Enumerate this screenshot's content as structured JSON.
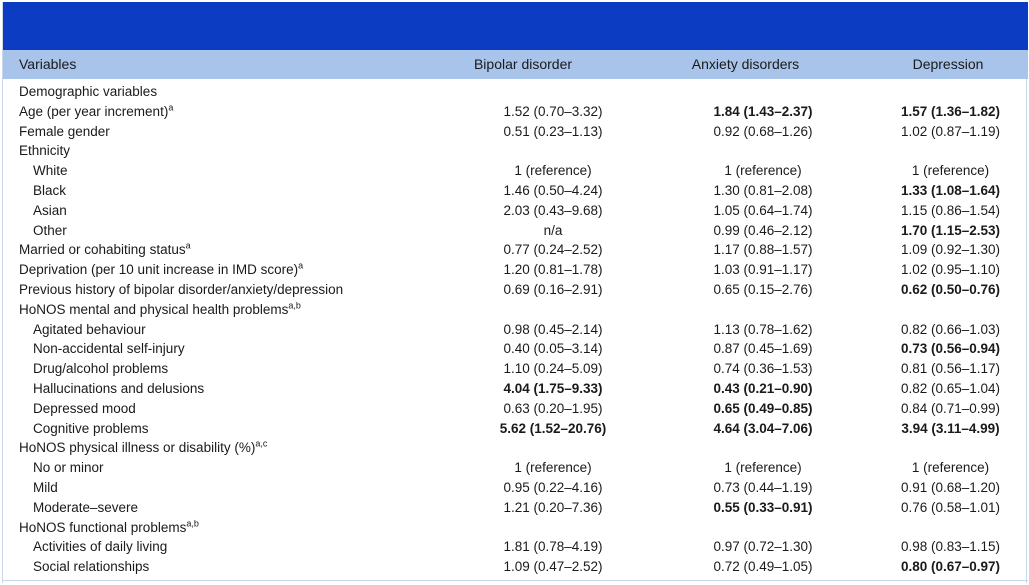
{
  "header": {
    "variables": "Variables",
    "bipolar": "Bipolar disorder",
    "anxiety": "Anxiety disorders",
    "depression": "Depression"
  },
  "rows": [
    {
      "label": "Demographic variables",
      "sup": "",
      "indent": false,
      "v": [
        "",
        "",
        ""
      ],
      "b": [
        false,
        false,
        false
      ]
    },
    {
      "label": "Age (per year increment)",
      "sup": "a",
      "indent": false,
      "v": [
        "1.52 (0.70–3.32)",
        "1.84 (1.43–2.37)",
        "1.57 (1.36–1.82)"
      ],
      "b": [
        false,
        true,
        true
      ]
    },
    {
      "label": "Female gender",
      "sup": "",
      "indent": false,
      "v": [
        "0.51 (0.23–1.13)",
        "0.92 (0.68–1.26)",
        "1.02 (0.87–1.19)"
      ],
      "b": [
        false,
        false,
        false
      ]
    },
    {
      "label": "Ethnicity",
      "sup": "",
      "indent": false,
      "v": [
        "",
        "",
        ""
      ],
      "b": [
        false,
        false,
        false
      ]
    },
    {
      "label": "White",
      "sup": "",
      "indent": true,
      "v": [
        "1 (reference)",
        "1 (reference)",
        "1 (reference)"
      ],
      "b": [
        false,
        false,
        false
      ]
    },
    {
      "label": "Black",
      "sup": "",
      "indent": true,
      "v": [
        "1.46 (0.50–4.24)",
        "1.30 (0.81–2.08)",
        "1.33 (1.08–1.64)"
      ],
      "b": [
        false,
        false,
        true
      ]
    },
    {
      "label": "Asian",
      "sup": "",
      "indent": true,
      "v": [
        "2.03 (0.43–9.68)",
        "1.05 (0.64–1.74)",
        "1.15 (0.86–1.54)"
      ],
      "b": [
        false,
        false,
        false
      ]
    },
    {
      "label": "Other",
      "sup": "",
      "indent": true,
      "v": [
        "n/a",
        "0.99 (0.46–2.12)",
        "1.70 (1.15–2.53)"
      ],
      "b": [
        false,
        false,
        true
      ]
    },
    {
      "label": "Married or cohabiting status",
      "sup": "a",
      "indent": false,
      "v": [
        "0.77 (0.24–2.52)",
        "1.17 (0.88–1.57)",
        "1.09 (0.92–1.30)"
      ],
      "b": [
        false,
        false,
        false
      ]
    },
    {
      "label": "Deprivation (per 10 unit increase in IMD score)",
      "sup": "a",
      "indent": false,
      "v": [
        "1.20 (0.81–1.78)",
        "1.03 (0.91–1.17)",
        "1.02 (0.95–1.10)"
      ],
      "b": [
        false,
        false,
        false
      ]
    },
    {
      "label": "Previous history of bipolar disorder/anxiety/depression",
      "sup": "",
      "indent": false,
      "v": [
        "0.69 (0.16–2.91)",
        "0.65 (0.15–2.76)",
        "0.62 (0.50–0.76)"
      ],
      "b": [
        false,
        false,
        true
      ]
    },
    {
      "label": "HoNOS mental and physical health problems",
      "sup": "a,b",
      "indent": false,
      "v": [
        "",
        "",
        ""
      ],
      "b": [
        false,
        false,
        false
      ]
    },
    {
      "label": "Agitated behaviour",
      "sup": "",
      "indent": true,
      "v": [
        "0.98 (0.45–2.14)",
        "1.13 (0.78–1.62)",
        "0.82 (0.66–1.03)"
      ],
      "b": [
        false,
        false,
        false
      ]
    },
    {
      "label": "Non-accidental self-injury",
      "sup": "",
      "indent": true,
      "v": [
        "0.40 (0.05–3.14)",
        "0.87 (0.45–1.69)",
        "0.73 (0.56–0.94)"
      ],
      "b": [
        false,
        false,
        true
      ]
    },
    {
      "label": "Drug/alcohol problems",
      "sup": "",
      "indent": true,
      "v": [
        "1.10 (0.24–5.09)",
        "0.74 (0.36–1.53)",
        "0.81 (0.56–1.17)"
      ],
      "b": [
        false,
        false,
        false
      ]
    },
    {
      "label": "Hallucinations and delusions",
      "sup": "",
      "indent": true,
      "v": [
        "4.04 (1.75–9.33)",
        "0.43 (0.21–0.90)",
        "0.82 (0.65–1.04)"
      ],
      "b": [
        true,
        true,
        false
      ]
    },
    {
      "label": "Depressed mood",
      "sup": "",
      "indent": true,
      "v": [
        "0.63 (0.20–1.95)",
        "0.65 (0.49–0.85)",
        "0.84 (0.71–0.99)"
      ],
      "b": [
        false,
        true,
        false
      ]
    },
    {
      "label": "Cognitive problems",
      "sup": "",
      "indent": true,
      "v": [
        "5.62 (1.52–20.76)",
        "4.64 (3.04–7.06)",
        "3.94 (3.11–4.99)"
      ],
      "b": [
        true,
        true,
        true
      ]
    },
    {
      "label": "HoNOS physical illness or disability (%)",
      "sup": "a,c",
      "indent": false,
      "v": [
        "",
        "",
        ""
      ],
      "b": [
        false,
        false,
        false
      ]
    },
    {
      "label": "No or minor",
      "sup": "",
      "indent": true,
      "v": [
        "1 (reference)",
        "1 (reference)",
        "1 (reference)"
      ],
      "b": [
        false,
        false,
        false
      ]
    },
    {
      "label": "Mild",
      "sup": "",
      "indent": true,
      "v": [
        "0.95 (0.22–4.16)",
        "0.73 (0.44–1.19)",
        "0.91 (0.68–1.20)"
      ],
      "b": [
        false,
        false,
        false
      ]
    },
    {
      "label": "Moderate–severe",
      "sup": "",
      "indent": true,
      "v": [
        "1.21 (0.20–7.36)",
        "0.55 (0.33–0.91)",
        "0.76 (0.58–1.01)"
      ],
      "b": [
        false,
        true,
        false
      ]
    },
    {
      "label": "HoNOS functional problems",
      "sup": "a,b",
      "indent": false,
      "v": [
        "",
        "",
        ""
      ],
      "b": [
        false,
        false,
        false
      ]
    },
    {
      "label": "Activities of daily living",
      "sup": "",
      "indent": true,
      "v": [
        "1.81 (0.78–4.19)",
        "0.97 (0.72–1.30)",
        "0.98 (0.83–1.15)"
      ],
      "b": [
        false,
        false,
        false
      ]
    },
    {
      "label": "Social relationships",
      "sup": "",
      "indent": true,
      "v": [
        "1.09 (0.47–2.52)",
        "0.72 (0.49–1.05)",
        "0.80 (0.67–0.97)"
      ],
      "b": [
        false,
        false,
        true
      ]
    }
  ]
}
